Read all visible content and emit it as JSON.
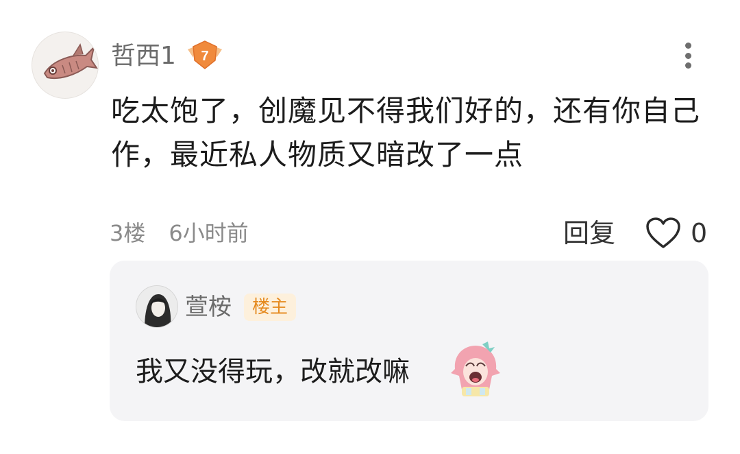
{
  "comment": {
    "username": "哲西1",
    "level": "7",
    "text": "吃太饱了，创魔见不得我们好的，还有你自己作，最近私人物质又暗改了一点",
    "floor": "3楼",
    "time": "6小时前",
    "reply_label": "回复",
    "like_count": "0"
  },
  "reply": {
    "username": "萱桉",
    "badge": "楼主",
    "text": "我又没得玩，改就改嘛"
  },
  "colors": {
    "card_bg": "#f4f4f6",
    "badge_bg": "#fdf0dc",
    "badge_text": "#e58a1f",
    "level_badge": "#f08a3c",
    "muted_text": "#8a8a8a"
  },
  "icons": [
    "fish-avatar-icon",
    "level-badge-icon",
    "more-dots-icon",
    "heart-icon",
    "anime-sticker-icon"
  ]
}
